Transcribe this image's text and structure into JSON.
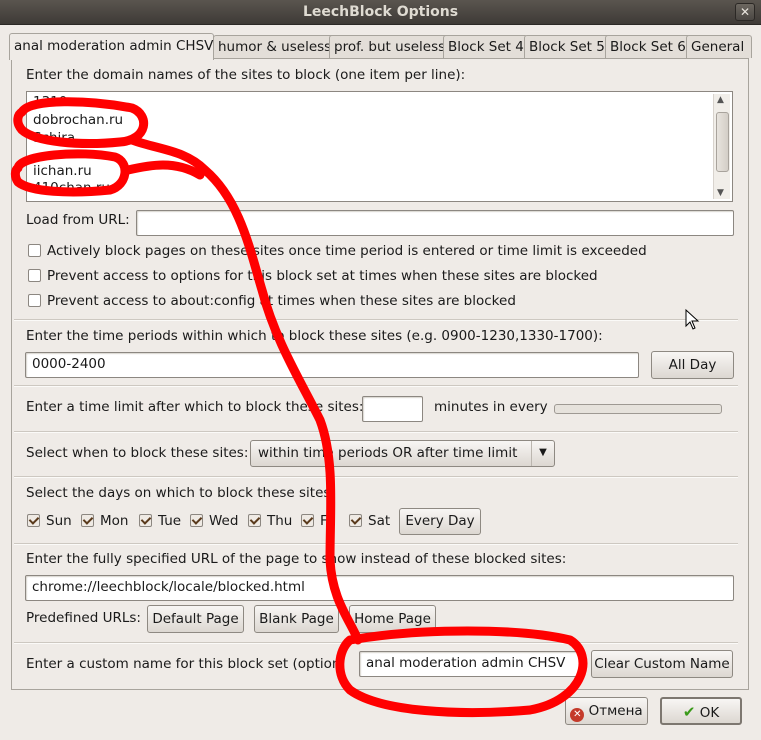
{
  "window": {
    "title": "LeechBlock Options",
    "close": "✕"
  },
  "tabs": [
    "anal moderation admin CHSV",
    "humor & useless",
    "prof. but useless",
    "Block Set 4",
    "Block Set 5",
    "Block Set 6",
    "General"
  ],
  "sites": {
    "label": "Enter the domain names of the sites to block (one item per line):",
    "lines": [
      "1310...",
      "dobrochan.ru",
      "Schira",
      "",
      "iichan.ru",
      "410chan.ru"
    ]
  },
  "load_url": {
    "label": "Load from URL:",
    "value": ""
  },
  "options": [
    {
      "label": "Actively block pages on these sites once time period is entered or time limit is exceeded",
      "checked": false
    },
    {
      "label": "Prevent access to options for this block set at times when these sites are blocked",
      "checked": false
    },
    {
      "label": "Prevent access to about:config at times when these sites are blocked",
      "checked": false
    }
  ],
  "periods": {
    "label": "Enter the time periods within which to block these sites (e.g. 0900-1230,1330-1700):",
    "value": "0000-2400",
    "all_day": "All Day"
  },
  "limit": {
    "label": "Enter a time limit after which to block these sites:",
    "value": "",
    "every": "minutes in every"
  },
  "when": {
    "label": "Select when to block these sites:",
    "selected": "within time periods OR after time limit"
  },
  "days": {
    "label": "Select the days on which to block these sites:",
    "items": [
      "Sun",
      "Mon",
      "Tue",
      "Wed",
      "Thu",
      "Fri",
      "Sat"
    ],
    "every_day": "Every Day"
  },
  "redirect": {
    "label": "Enter the fully specified URL of the page to show instead of these blocked sites:",
    "value": "chrome://leechblock/locale/blocked.html",
    "predefined_label": "Predefined URLs:",
    "default_page": "Default Page",
    "blank_page": "Blank Page",
    "home_page": "Home Page"
  },
  "custom_name": {
    "label": "Enter a custom name for this block set (optional):",
    "value": "anal moderation admin CHSV",
    "clear": "Clear Custom Name"
  },
  "footer": {
    "cancel": "Отмена",
    "ok": "OK"
  },
  "colors": {
    "annotation": "#ff0000",
    "titlebar": "#4a4540",
    "window_bg": "#efebe7"
  }
}
